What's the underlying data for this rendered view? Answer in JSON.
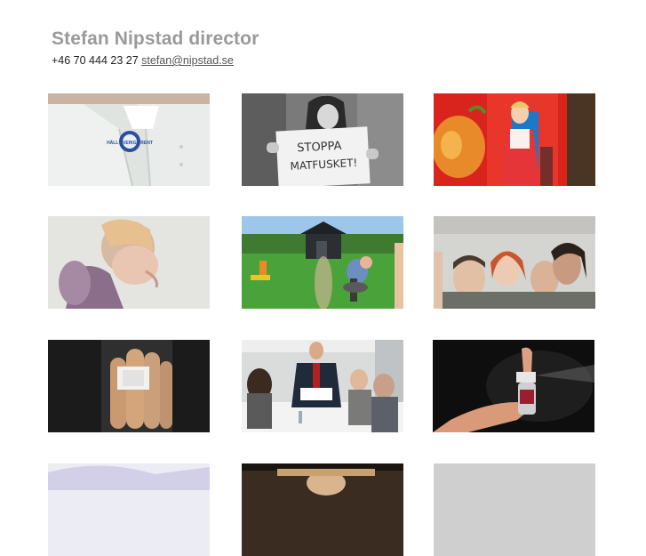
{
  "header": {
    "title": "Stefan Nipstad director",
    "phone": "+46 70 444 23 27",
    "email": "stefan@nipstad.se"
  },
  "thumbnails": [
    {
      "name": "thumb-white-jacket-badge",
      "badge_text": "HÄLL SVERIGE RENT"
    },
    {
      "name": "thumb-protest-sign",
      "sign_text": "STOPPA MATFUSKET!"
    },
    {
      "name": "thumb-orange-cartoon"
    },
    {
      "name": "thumb-woman-profile"
    },
    {
      "name": "thumb-garden-barbecue"
    },
    {
      "name": "thumb-laughing-group"
    },
    {
      "name": "thumb-bandaged-fingers"
    },
    {
      "name": "thumb-meeting-room"
    },
    {
      "name": "thumb-hand-spray-bottle"
    },
    {
      "name": "thumb-row4-col1"
    },
    {
      "name": "thumb-row4-col2"
    },
    {
      "name": "thumb-row4-col3"
    }
  ]
}
